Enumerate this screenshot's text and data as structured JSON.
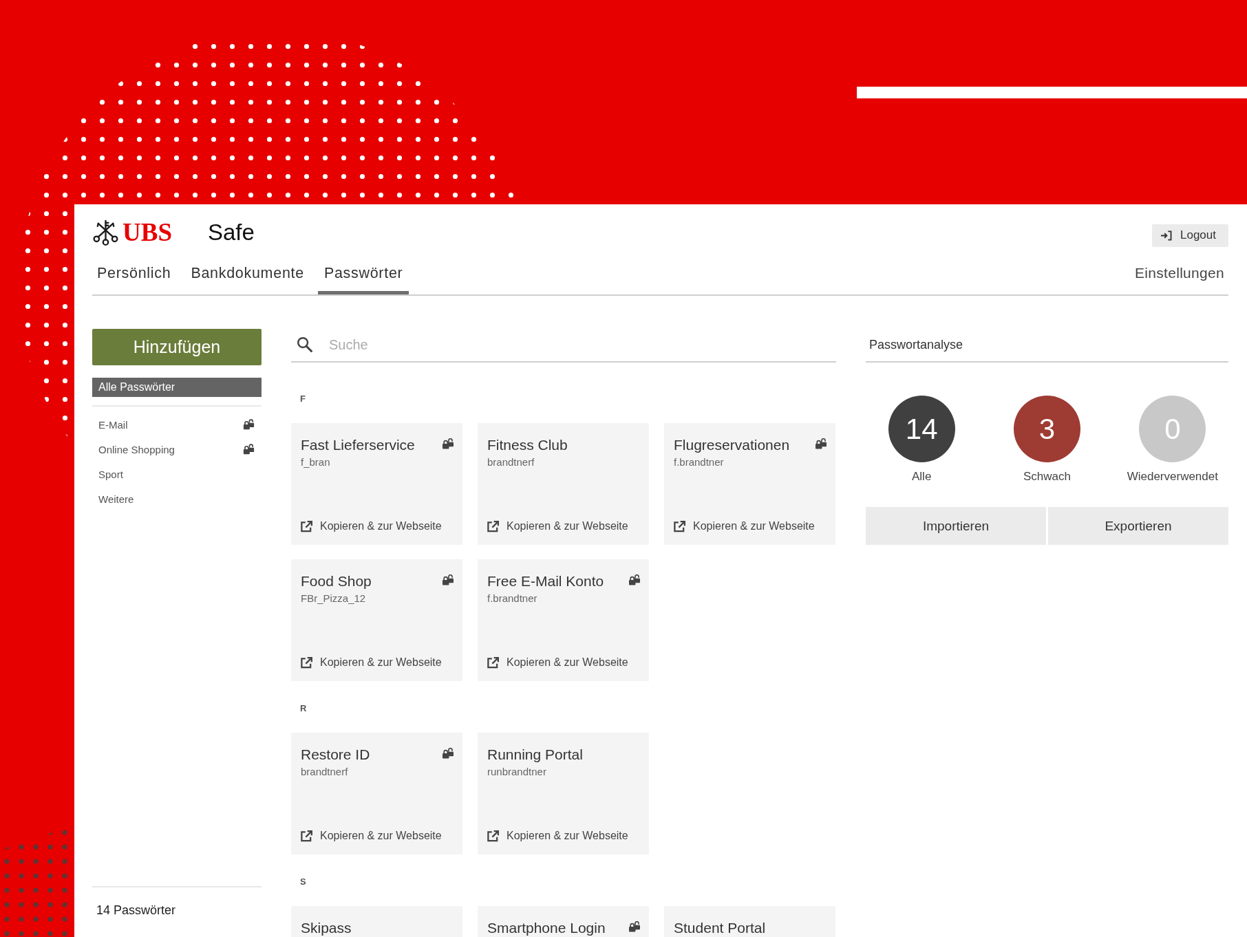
{
  "header": {
    "logo": "UBS",
    "app_title": "Safe",
    "logout_button": "Logout"
  },
  "tabs": [
    {
      "label": "Persönlich",
      "selected": false
    },
    {
      "label": "Bankdokumente",
      "selected": false
    },
    {
      "label": "Passwörter",
      "selected": true
    }
  ],
  "settings_link": "Einstellungen",
  "sidebar": {
    "add_button": "Hinzufügen",
    "categories": [
      {
        "label": "Alle Passwörter",
        "selected": true,
        "lock_icon": false
      },
      {
        "label": "E-Mail",
        "selected": false,
        "lock_icon": true
      },
      {
        "label": "Online Shopping",
        "selected": false,
        "lock_icon": true
      },
      {
        "label": "Sport",
        "selected": false,
        "lock_icon": false
      },
      {
        "label": "Weitere",
        "selected": false,
        "lock_icon": false
      }
    ],
    "count": "14 Passwörter"
  },
  "search": {
    "placeholder": "Suche"
  },
  "groups": [
    {
      "letter": "F",
      "entries": [
        {
          "title": "Fast Lieferservice",
          "username": "f_bran",
          "lock_icon": true,
          "action": "Kopieren & zur Webseite"
        },
        {
          "title": "Fitness Club",
          "username": "brandtnerf",
          "lock_icon": false,
          "action": "Kopieren & zur Webseite"
        },
        {
          "title": "Flugreservationen",
          "username": "f.brandtner",
          "lock_icon": true,
          "action": "Kopieren & zur Webseite"
        },
        {
          "title": "Food Shop",
          "username": "FBr_Pizza_12",
          "lock_icon": true,
          "action": "Kopieren & zur Webseite"
        },
        {
          "title": "Free E-Mail Konto",
          "username": "f.brandtner",
          "lock_icon": true,
          "action": "Kopieren & zur Webseite"
        }
      ]
    },
    {
      "letter": "R",
      "entries": [
        {
          "title": "Restore ID",
          "username": "brandtnerf",
          "lock_icon": true,
          "action": "Kopieren & zur Webseite"
        },
        {
          "title": "Running Portal",
          "username": "runbrandtner",
          "lock_icon": false,
          "action": "Kopieren & zur Webseite"
        }
      ]
    },
    {
      "letter": "S",
      "entries": [
        {
          "title": "Skipass",
          "lock_icon": false
        },
        {
          "title": "Smartphone Login",
          "lock_icon": true
        },
        {
          "title": "Student Portal",
          "lock_icon": false
        }
      ]
    }
  ],
  "analysis": {
    "title": "Passwortanalyse",
    "stats": [
      {
        "value": "14",
        "label": "Alle",
        "color": "#404040"
      },
      {
        "value": "3",
        "label": "Schwach",
        "color": "#9e3b33"
      },
      {
        "value": "0",
        "label": "Wiederverwendet",
        "color": "#c8c8c8"
      }
    ],
    "import_button": "Importieren",
    "export_button": "Exportieren"
  }
}
